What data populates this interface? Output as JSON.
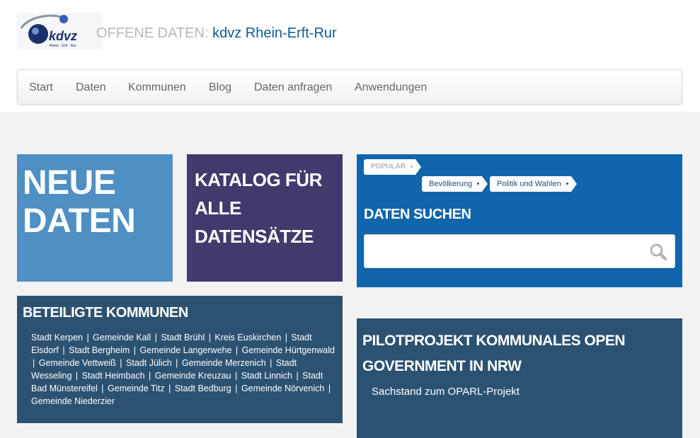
{
  "header": {
    "logo_text": "kdvz",
    "logo_subtext": "Rhein · Erft · Rur",
    "title_prefix": "OFFENE DATEN:",
    "title_brand": "kdvz Rhein-Erft-Rur"
  },
  "nav": {
    "items": [
      "Start",
      "Daten",
      "Kommunen",
      "Blog",
      "Daten anfragen",
      "Anwendungen"
    ]
  },
  "tiles": {
    "new_data": {
      "line1": "NEUE",
      "line2": "DATEN"
    },
    "catalog": {
      "title": "KATALOG FÜR ALLE DATENSÄTZE"
    },
    "search": {
      "popular_label": "POPULAR",
      "tags": [
        "Bevölkerung",
        "Politik und Wahlen"
      ],
      "heading": "DATEN SUCHEN",
      "input_value": "",
      "placeholder": ""
    },
    "kommunen": {
      "heading": "BETEILIGTE KOMMUNEN",
      "items": [
        "Stadt Kerpen",
        "Gemeinde Kall",
        "Stadt Brühl",
        "Kreis Euskirchen",
        "Stadt Elsdorf",
        "Stadt Bergheim",
        "Gemeinde Langerwehe",
        "Gemeinde Hürtgenwald",
        "Gemeinde Vettweiß",
        "Stadt Jülich",
        "Gemeinde Merzenich",
        "Stadt Wesseling",
        "Stadt Heimbach",
        "Gemeinde Kreuzau",
        "Stadt Linnich",
        "Stadt Bad Münstereifel",
        "Gemeinde Titz",
        "Stadt Bedburg",
        "Gemeinde Nörvenich",
        "Gemeinde Niederzier"
      ],
      "separator": "|"
    },
    "pilot": {
      "heading": "PILOTPROJEKT KOMMUNALES OPEN GOVERNMENT IN NRW",
      "link": "Sachstand zum OPARL-Projekt"
    }
  },
  "colors": {
    "tile_new": "#4e8fc4",
    "tile_catalog": "#413a6c",
    "tile_search": "#1165aa",
    "tile_dark": "#2c5272",
    "brand": "#0f5a92"
  }
}
